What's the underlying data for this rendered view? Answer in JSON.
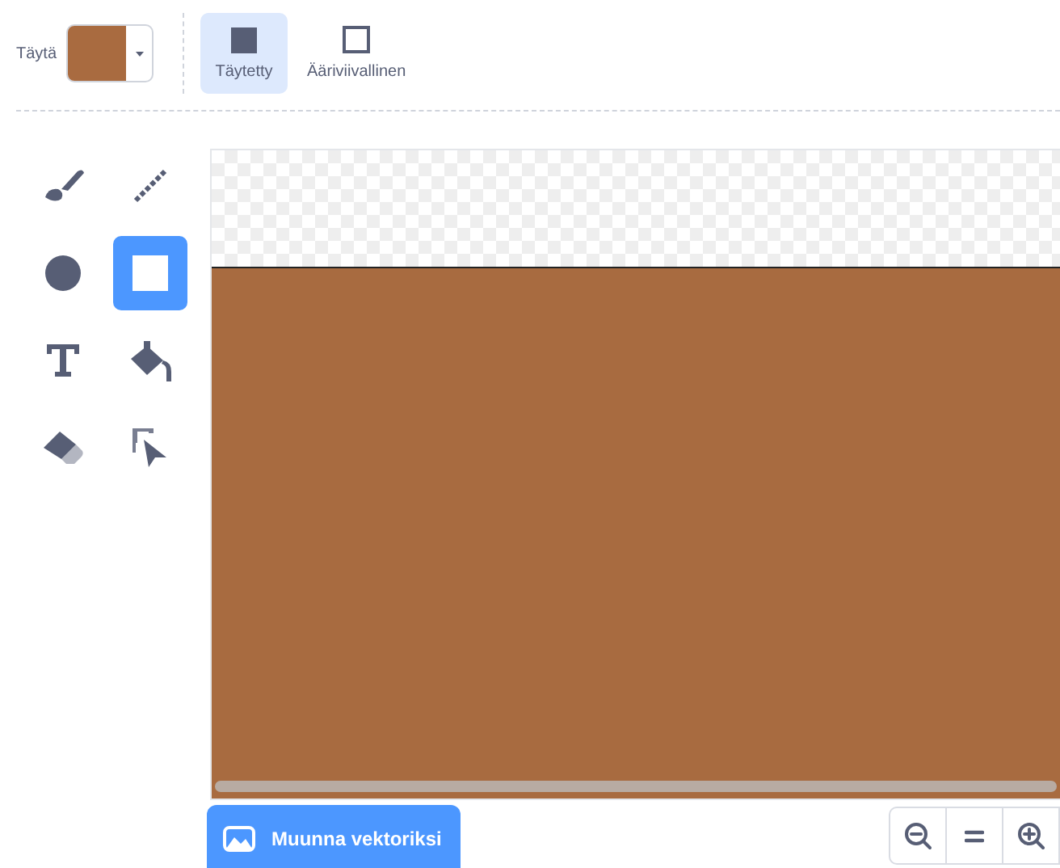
{
  "fill": {
    "label": "Täytä",
    "color": "#a96b40"
  },
  "fill_modes": [
    {
      "kind": "filled",
      "label": "Täytetty",
      "selected": true
    },
    {
      "kind": "outlined",
      "label": "Ääriviivallinen",
      "selected": false
    }
  ],
  "tools": [
    {
      "kind": "brush",
      "selected": false
    },
    {
      "kind": "line",
      "selected": false
    },
    {
      "kind": "circle",
      "selected": false
    },
    {
      "kind": "rectangle",
      "selected": true
    },
    {
      "kind": "text",
      "selected": false
    },
    {
      "kind": "fill",
      "selected": false
    },
    {
      "kind": "eraser",
      "selected": false
    },
    {
      "kind": "select",
      "selected": false
    }
  ],
  "convert_button": {
    "label": "Muunna vektoriksi"
  }
}
